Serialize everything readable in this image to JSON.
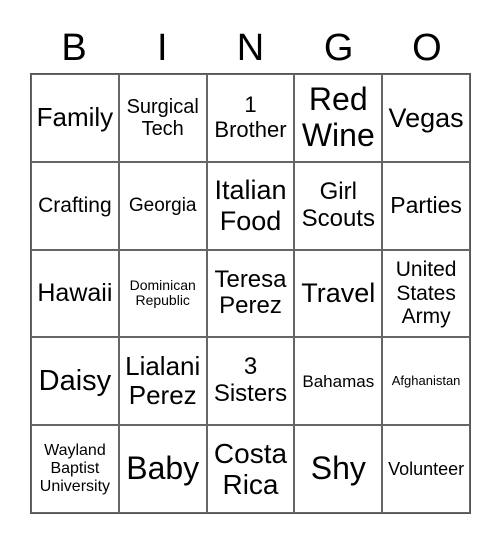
{
  "header": [
    "B",
    "I",
    "N",
    "G",
    "O"
  ],
  "cells": [
    [
      "Family",
      "Surgical\nTech",
      "1\nBrother",
      "Red\nWine",
      "Vegas"
    ],
    [
      "Crafting",
      "Georgia",
      "Italian\nFood",
      "Girl\nScouts",
      "Parties"
    ],
    [
      "Hawaii",
      "Dominican\nRepublic",
      "Teresa\nPerez",
      "Travel",
      "United\nStates\nArmy"
    ],
    [
      "Daisy",
      "Lialani\nPerez",
      "3\nSisters",
      "Bahamas",
      "Afghanistan"
    ],
    [
      "Wayland\nBaptist\nUniversity",
      "Baby",
      "Costa\nRica",
      "Shy",
      "Volunteer"
    ]
  ]
}
